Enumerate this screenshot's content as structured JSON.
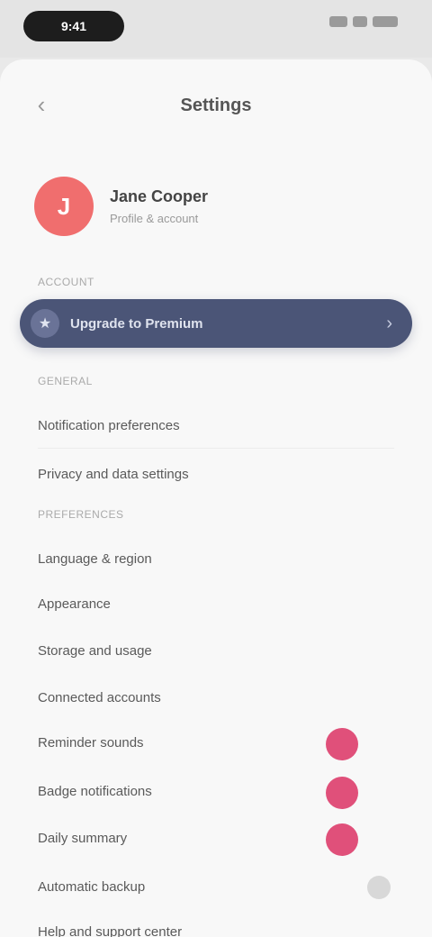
{
  "status": {
    "time": "9:41"
  },
  "header": {
    "title": "Settings",
    "back_icon": "chevron-left-icon"
  },
  "profile": {
    "initial": "J",
    "name": "Jane Cooper",
    "subtitle": "Profile & account"
  },
  "sections": {
    "account": "ACCOUNT",
    "general": "GENERAL",
    "preferences": "PREFERENCES"
  },
  "banner": {
    "label": "Upgrade to Premium",
    "icon": "star-icon"
  },
  "rows": [
    {
      "label": "Notification preferences"
    },
    {
      "label": "Privacy and data settings"
    },
    {
      "label": "Language & region"
    },
    {
      "label": "Appearance"
    },
    {
      "label": "Storage and usage"
    },
    {
      "label": "Connected accounts"
    },
    {
      "label": "Reminder sounds"
    },
    {
      "label": "Badge notifications"
    },
    {
      "label": "Daily summary"
    },
    {
      "label": "Automatic backup"
    },
    {
      "label": "Help and support center"
    }
  ],
  "colors": {
    "banner": "#4b5577",
    "avatar": "#f06e6e",
    "accent_dot": "#e0507a"
  }
}
